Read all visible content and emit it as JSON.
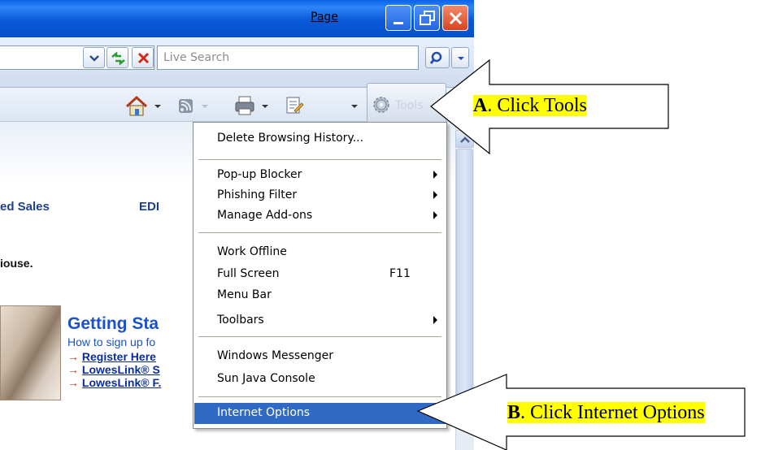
{
  "window": {
    "caption_buttons": [
      "minimize",
      "restore",
      "close"
    ]
  },
  "address_bar": {
    "search_placeholder": "Live Search"
  },
  "command_bar": {
    "page_label": "Page",
    "tools_label": "Tools"
  },
  "page": {
    "nav_sales": "ed Sales",
    "nav_edi": "EDI",
    "house_text": "iouse.",
    "getting_started_title": "Getting Sta",
    "getting_started_sub": "How to sign up fo",
    "links": [
      {
        "arrow": "→",
        "text": "Register Here"
      },
      {
        "arrow": "→",
        "text": "LowesLink® S"
      },
      {
        "arrow": "→",
        "text": "LowesLink® F."
      }
    ]
  },
  "tools_menu": {
    "items": [
      {
        "label": "Delete Browsing History...",
        "shortcut": "",
        "submenu": false
      },
      {
        "label": "Pop-up Blocker",
        "shortcut": "",
        "submenu": true
      },
      {
        "label": "Phishing Filter",
        "shortcut": "",
        "submenu": true
      },
      {
        "label": "Manage Add-ons",
        "shortcut": "",
        "submenu": true
      },
      {
        "label": "Work Offline",
        "shortcut": "",
        "submenu": false
      },
      {
        "label": "Full Screen",
        "shortcut": "F11",
        "submenu": false
      },
      {
        "label": "Menu Bar",
        "shortcut": "",
        "submenu": false
      },
      {
        "label": "Toolbars",
        "shortcut": "",
        "submenu": true
      },
      {
        "label": "Windows Messenger",
        "shortcut": "",
        "submenu": false
      },
      {
        "label": "Sun Java Console",
        "shortcut": "",
        "submenu": false
      },
      {
        "label": "Internet Options",
        "shortcut": "",
        "submenu": false,
        "highlighted": true
      }
    ]
  },
  "callouts": {
    "a_letter": "A",
    "a_text": ". Click Tools",
    "b_letter": "B",
    "b_text": ".  Click Internet Options"
  },
  "colors": {
    "titlebar": "#0a58d8",
    "menu_highlight": "#316ac5",
    "callout_highlight": "#ffff00",
    "link_blue": "#0a2c9e"
  }
}
